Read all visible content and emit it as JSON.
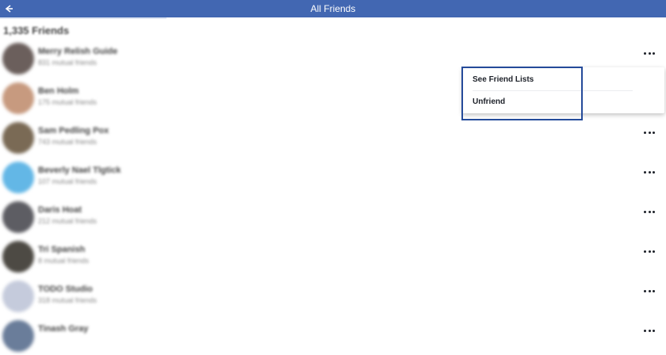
{
  "header": {
    "title": "All Friends",
    "back_icon": "back-arrow-icon",
    "background": "#4267b2"
  },
  "friends_count": "1,335 Friends",
  "friends": [
    {
      "name": "Merry Relish Guide",
      "sub": "831 mutual friends",
      "avatar_color": "#6b5f5c"
    },
    {
      "name": "Ben Holm",
      "sub": "175 mutual friends",
      "avatar_color": "#c79a7f"
    },
    {
      "name": "Sam Pedling Pox",
      "sub": "743 mutual friends",
      "avatar_color": "#7a6a55"
    },
    {
      "name": "Beverly Nael Tlgtick",
      "sub": "107 mutual friends",
      "avatar_color": "#63b7e6"
    },
    {
      "name": "Daris Hoat",
      "sub": "212 mutual friends",
      "avatar_color": "#5d5d63"
    },
    {
      "name": "Tri Spanish",
      "sub": "8 mutual friends",
      "avatar_color": "#4d4a44"
    },
    {
      "name": "TODO Studio",
      "sub": "318 mutual friends",
      "avatar_color": "#c5cbdc"
    },
    {
      "name": "Tinash Gray",
      "sub": "",
      "avatar_color": "#6a7d9a"
    }
  ],
  "more_icon": "more-options-icon",
  "context_menu": {
    "items": [
      "See Friend Lists",
      "Unfriend"
    ]
  },
  "highlight_color": "#254b9a"
}
